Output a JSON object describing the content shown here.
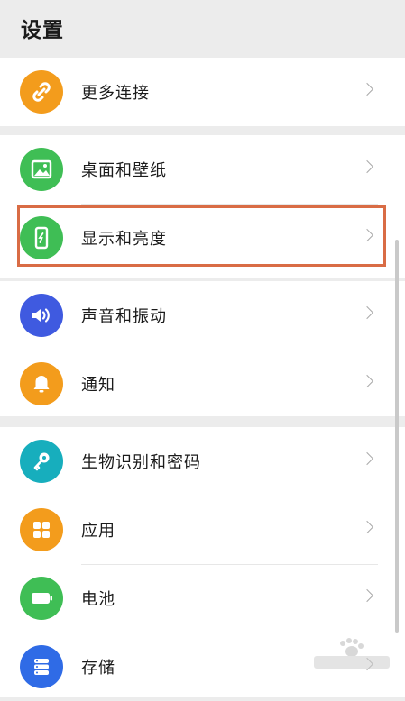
{
  "title": "设置",
  "groups": [
    {
      "items": [
        {
          "label": "更多连接",
          "icon": "link-icon",
          "color": "#f39c1c"
        }
      ]
    },
    {
      "items": [
        {
          "label": "桌面和壁纸",
          "icon": "image-icon",
          "color": "#3fbe55"
        },
        {
          "label": "显示和亮度",
          "icon": "phone-display-icon",
          "color": "#3fbe55"
        }
      ]
    },
    {
      "items": [
        {
          "label": "声音和振动",
          "icon": "speaker-icon",
          "color": "#3f5ae0"
        },
        {
          "label": "通知",
          "icon": "bell-icon",
          "color": "#f39c1c"
        }
      ]
    },
    {
      "items": [
        {
          "label": "生物识别和密码",
          "icon": "key-icon",
          "color": "#17aebd"
        },
        {
          "label": "应用",
          "icon": "apps-grid-icon",
          "color": "#f39c1c"
        },
        {
          "label": "电池",
          "icon": "battery-icon",
          "color": "#3fbe55"
        },
        {
          "label": "存储",
          "icon": "storage-icon",
          "color": "#2f6be6"
        }
      ]
    }
  ],
  "highlight_color": "#d96c45"
}
